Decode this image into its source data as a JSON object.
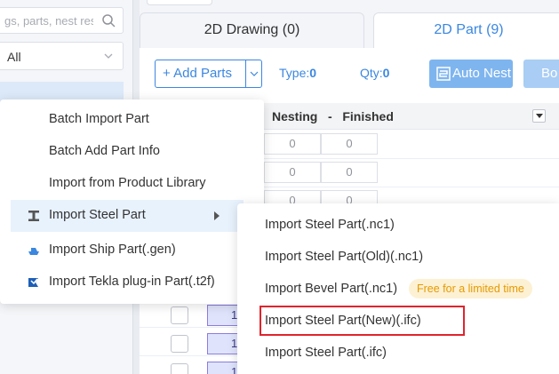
{
  "left_panel": {
    "search_placeholder": "gs, parts, nest resu",
    "filter_value": "All"
  },
  "tabs": [
    {
      "label": "2D Drawing  (0)",
      "active": false
    },
    {
      "label": "2D Part  (9)",
      "active": true
    }
  ],
  "toolbar": {
    "add_parts_label": "+ Add Parts",
    "type_label": "Type:",
    "type_value": "0",
    "qty_label": "Qty:",
    "qty_value": "0",
    "auto_nest_label": "Auto Nest",
    "next_button_label": "Bo"
  },
  "table": {
    "header_nesting": "Nesting   -   Finished",
    "rows": [
      {
        "nesting": "0",
        "finished": "0"
      },
      {
        "nesting": "0",
        "finished": "0"
      },
      {
        "nesting": "0",
        "finished": "0"
      }
    ],
    "lower_rows": [
      {
        "qty": "1"
      },
      {
        "qty": "1"
      },
      {
        "qty": "1"
      }
    ]
  },
  "context_menu": {
    "items": [
      {
        "label": "Batch Import Part",
        "icon": ""
      },
      {
        "label": "Batch Add Part Info",
        "icon": ""
      },
      {
        "label": "Import from Product Library",
        "icon": ""
      },
      {
        "label": "Import Steel Part",
        "icon": "steel-beam-icon",
        "has_submenu": true
      },
      {
        "label": "Import Ship Part(.gen)",
        "icon": "ship-icon"
      },
      {
        "label": "Import Tekla plug-in Part(.t2f)",
        "icon": "tekla-icon"
      }
    ]
  },
  "submenu": {
    "items": [
      {
        "label": "Import Steel Part(.nc1)"
      },
      {
        "label": "Import Steel Part(Old)(.nc1)"
      },
      {
        "label": "Import Bevel Part(.nc1)",
        "badge": "Free for a limited time"
      },
      {
        "label": "Import Steel Part(New)(.ifc)",
        "highlighted": true
      },
      {
        "label": "Import Steel Part(.ifc)"
      }
    ]
  },
  "colors": {
    "accent": "#3b87e0",
    "highlight_box": "#e0242d",
    "badge_bg": "#fdf1d4",
    "badge_text": "#e69a00"
  }
}
